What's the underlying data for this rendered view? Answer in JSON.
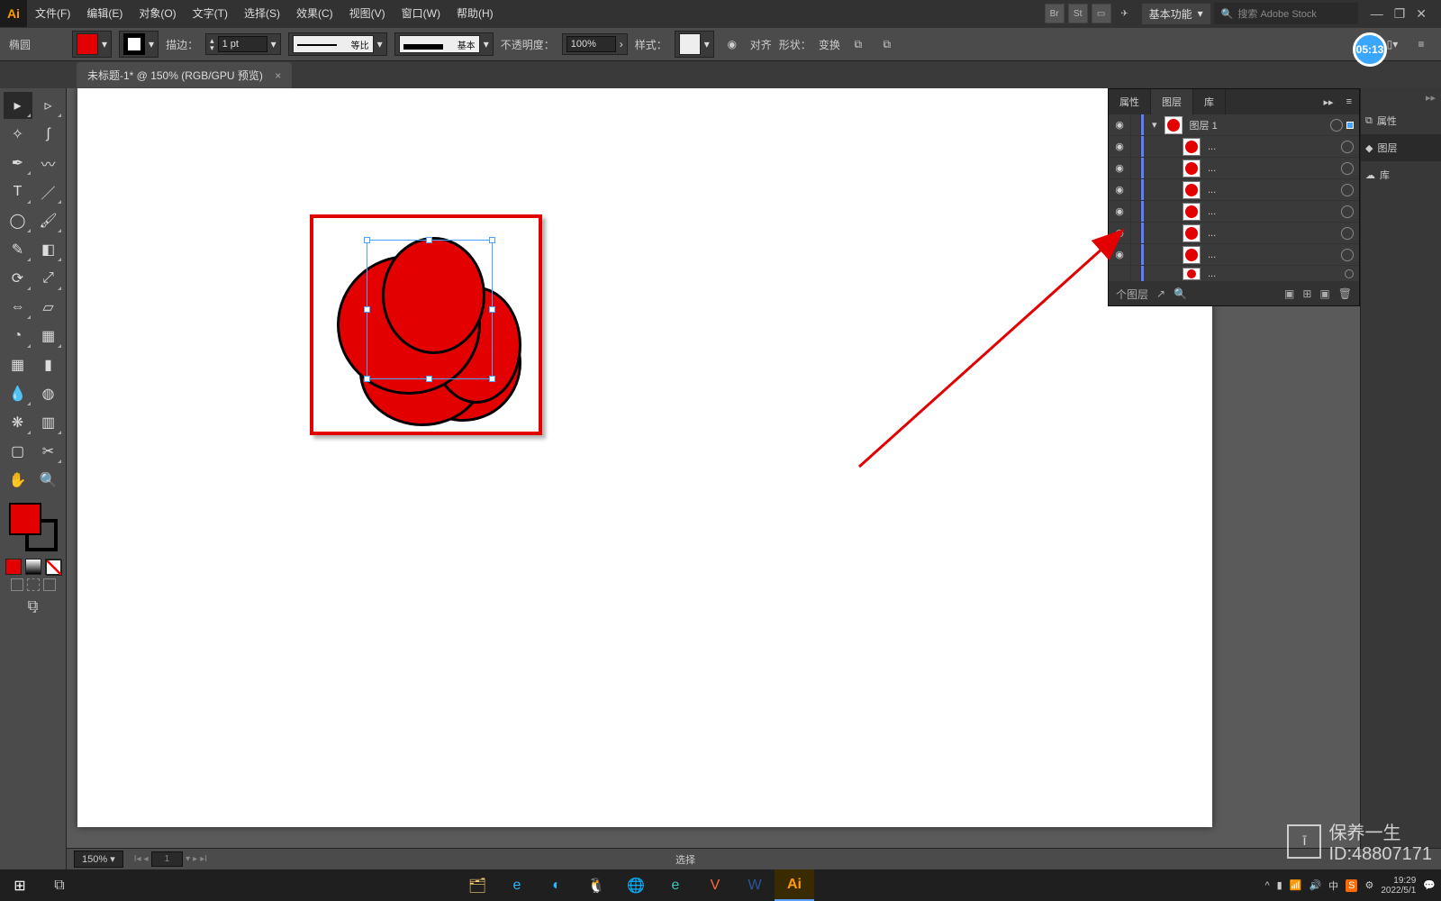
{
  "menu": {
    "items": [
      "文件(F)",
      "编辑(E)",
      "对象(O)",
      "文字(T)",
      "选择(S)",
      "效果(C)",
      "视图(V)",
      "窗口(W)",
      "帮助(H)"
    ],
    "workspace": "基本功能",
    "search_placeholder": "搜索 Adobe Stock"
  },
  "options": {
    "tool": "椭圆",
    "stroke_label": "描边：",
    "stroke_pt": "1 pt",
    "prof1": "等比",
    "prof2": "基本",
    "opacity_label": "不透明度：",
    "opacity": "100%",
    "style_label": "样式：",
    "align": "对齐",
    "shape": "形状：",
    "transform": "变换"
  },
  "clock_badge": "05:13",
  "tab": {
    "title": "未标题-1* @ 150% (RGB/GPU 预览)",
    "close": "×"
  },
  "right_strip": {
    "props": "属性",
    "layers": "图层",
    "lib": "库"
  },
  "layers": {
    "tabs": [
      "属性",
      "图层",
      "库"
    ],
    "top": "图层 1",
    "sublabel": "...",
    "footer": "个图层"
  },
  "status": {
    "zoom": "150%",
    "page": "1",
    "select": "选择"
  },
  "tray": {
    "ime": "中",
    "time": "19:29",
    "date": "2022/5/1"
  },
  "watermark": {
    "line1": "保养一生",
    "line2": "ID:48807171"
  }
}
